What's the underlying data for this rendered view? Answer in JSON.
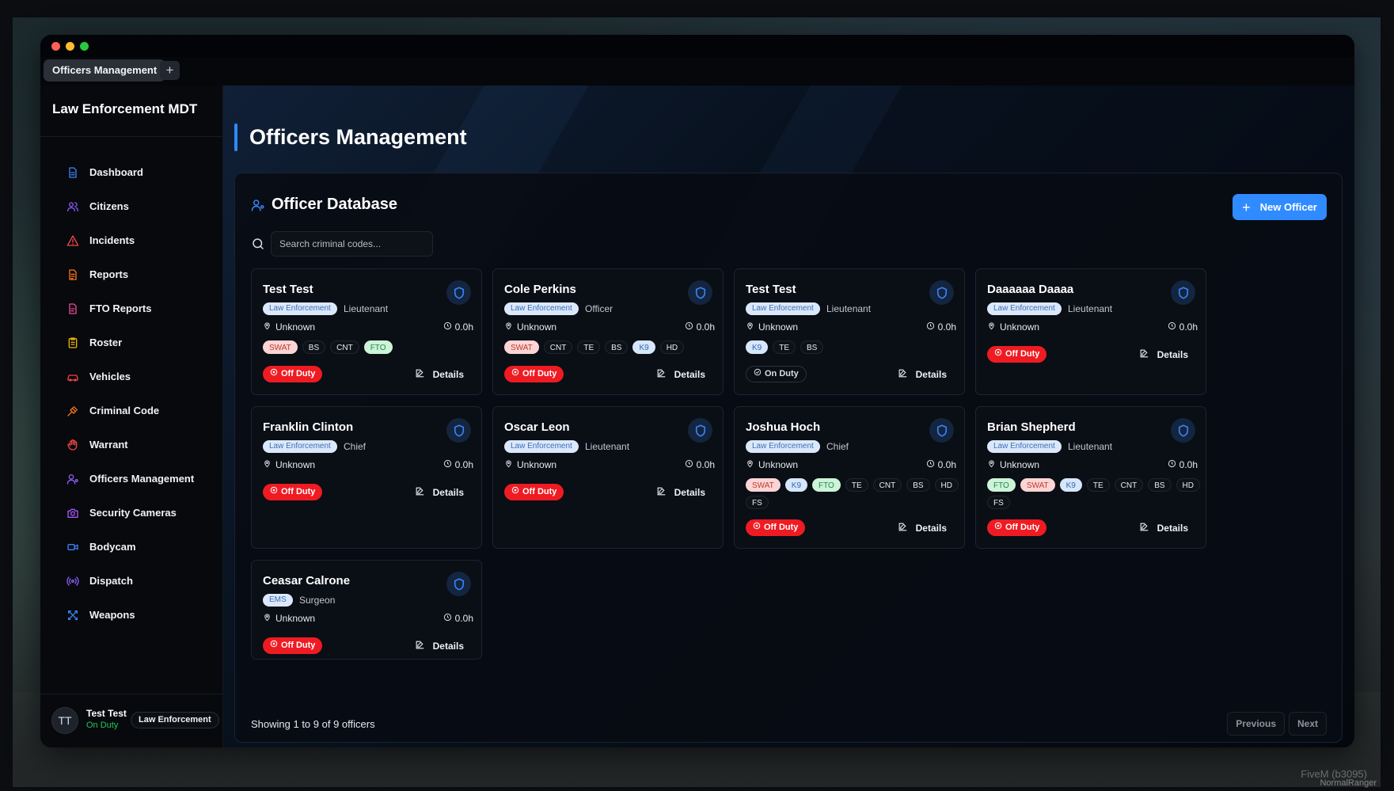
{
  "window": {
    "tab_label": "Officers Management",
    "tab_add": "+"
  },
  "sidebar": {
    "title": "Law Enforcement MDT",
    "items": [
      {
        "label": "Dashboard",
        "icon": "document-icon",
        "color": "#3b82f6"
      },
      {
        "label": "Citizens",
        "icon": "users-icon",
        "color": "#8b5cf6"
      },
      {
        "label": "Incidents",
        "icon": "warning-icon",
        "color": "#ef4444"
      },
      {
        "label": "Reports",
        "icon": "report-icon",
        "color": "#f97316"
      },
      {
        "label": "FTO Reports",
        "icon": "fto-report-icon",
        "color": "#ec4899"
      },
      {
        "label": "Roster",
        "icon": "clipboard-icon",
        "color": "#eab308"
      },
      {
        "label": "Vehicles",
        "icon": "car-icon",
        "color": "#ef4444"
      },
      {
        "label": "Criminal Code",
        "icon": "gavel-icon",
        "color": "#f97316"
      },
      {
        "label": "Warrant",
        "icon": "hand-icon",
        "color": "#ef4444"
      },
      {
        "label": "Officers Management",
        "icon": "user-cog-icon",
        "color": "#8b5cf6"
      },
      {
        "label": "Security Cameras",
        "icon": "camera-icon",
        "color": "#a855f7"
      },
      {
        "label": "Bodycam",
        "icon": "video-icon",
        "color": "#3b82f6"
      },
      {
        "label": "Dispatch",
        "icon": "radio-icon",
        "color": "#8b5cf6"
      },
      {
        "label": "Weapons",
        "icon": "crossed-swords-icon",
        "color": "#3b82f6"
      }
    ],
    "user": {
      "initials": "TT",
      "name": "Test Test",
      "status": "On Duty",
      "department": "Law Enforcement"
    }
  },
  "main": {
    "page_title": "Officers Management",
    "panel_title": "Officer Database",
    "new_button": "New Officer",
    "search": {
      "placeholder": "Search criminal codes...",
      "value": ""
    },
    "officers": [
      {
        "name": "Test Test",
        "department": "Law Enforcement",
        "rank": "Lieutenant",
        "location": "Unknown",
        "hours": "0.0h",
        "tags": [
          "SWAT",
          "BS",
          "CNT",
          "FTO"
        ],
        "status": "Off Duty",
        "details": "Details"
      },
      {
        "name": "Cole Perkins",
        "department": "Law Enforcement",
        "rank": "Officer",
        "location": "Unknown",
        "hours": "0.0h",
        "tags": [
          "SWAT",
          "CNT",
          "TE",
          "BS",
          "K9",
          "HD"
        ],
        "status": "Off Duty",
        "details": "Details"
      },
      {
        "name": "Test Test",
        "department": "Law Enforcement",
        "rank": "Lieutenant",
        "location": "Unknown",
        "hours": "0.0h",
        "tags": [
          "K9",
          "TE",
          "BS"
        ],
        "status": "On Duty",
        "details": "Details"
      },
      {
        "name": "Daaaaaa Daaaa",
        "department": "Law Enforcement",
        "rank": "Lieutenant",
        "location": "Unknown",
        "hours": "0.0h",
        "tags": [],
        "status": "Off Duty",
        "details": "Details"
      },
      {
        "name": "Franklin Clinton",
        "department": "Law Enforcement",
        "rank": "Chief",
        "location": "Unknown",
        "hours": "0.0h",
        "tags": [],
        "status": "Off Duty",
        "details": "Details"
      },
      {
        "name": "Oscar Leon",
        "department": "Law Enforcement",
        "rank": "Lieutenant",
        "location": "Unknown",
        "hours": "0.0h",
        "tags": [],
        "status": "Off Duty",
        "details": "Details"
      },
      {
        "name": "Joshua Hoch",
        "department": "Law Enforcement",
        "rank": "Chief",
        "location": "Unknown",
        "hours": "0.0h",
        "tags": [
          "SWAT",
          "K9",
          "FTO",
          "TE",
          "CNT",
          "BS",
          "HD",
          "FS"
        ],
        "status": "Off Duty",
        "details": "Details"
      },
      {
        "name": "Brian Shepherd",
        "department": "Law Enforcement",
        "rank": "Lieutenant",
        "location": "Unknown",
        "hours": "0.0h",
        "tags": [
          "FTO",
          "SWAT",
          "K9",
          "TE",
          "CNT",
          "BS",
          "HD",
          "FS"
        ],
        "status": "Off Duty",
        "details": "Details"
      },
      {
        "name": "Ceasar Calrone",
        "department": "EMS",
        "rank": "Surgeon",
        "location": "Unknown",
        "hours": "0.0h",
        "tags": [],
        "status": "Off Duty",
        "details": "Details"
      }
    ],
    "showing_text": "Showing 1 to 9 of 9 officers",
    "pagination": {
      "previous": "Previous",
      "next": "Next"
    }
  },
  "overlay": {
    "watermark": "FiveM (b3095)",
    "player_name": "NormalRanger"
  },
  "colors": {
    "accent": "#2f8bff",
    "off_duty": "#ef1b22",
    "on_duty": "#22c55e"
  }
}
